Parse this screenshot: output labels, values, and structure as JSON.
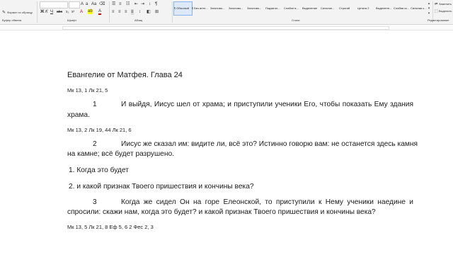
{
  "ribbon": {
    "clipboard": {
      "format_painter": "Формат по образцу",
      "group_label": "Буфер обмена"
    },
    "font": {
      "group_label": "Шрифт",
      "bold": "Ж",
      "italic": "К",
      "underline": "Ч",
      "strike": "abc",
      "subscript": "x₂",
      "superscript": "x²",
      "color": "А"
    },
    "paragraph": {
      "group_label": "Абзац"
    },
    "styles": {
      "group_label": "Стили",
      "items": [
        "¶ Обычный",
        "¶ Без инте...",
        "Заголово...",
        "Заголово...",
        "Заголово...",
        "Подзагол...",
        "Слабое в...",
        "Выделение",
        "Сильное...",
        "Строгий",
        "Цитата 2",
        "Выделенн...",
        "Слабая сс...",
        "Сильная с..."
      ]
    },
    "editing": {
      "replace": "Заменить",
      "select": "Выделить",
      "group_label": "Редактирование"
    }
  },
  "document": {
    "title": "Евангелие от Матфея. Глава 24",
    "ref1": "Мк 13, 1 Лк 21, 5",
    "v1_num": "1",
    "v1_line1": "И выйдя, Иисус шел от храма; и приступили ученики Его, чтобы показать Ему здания",
    "v1_line2": "храма.",
    "ref2": "Мк 13, 2 Лк 19, 44 Лк 21, 6",
    "v2_num": "2",
    "v2_line1": "Иисус же сказал им: видите ли, всё это? Истинно говорю вам: не останется здесь камня",
    "v2_line2": "на камне; всё будет разрушено.",
    "list1": "1. Когда это будет",
    "list2": "2. и какой признак Твоего пришествия и кончины века?",
    "v3_num": "3",
    "v3_line1": "Когда же сидел Он на горе Елеонской, то приступили к Нему ученики наедине и",
    "v3_line2": "спросили: скажи нам, когда это будет? и какой признак Твоего пришествия и кончины века?",
    "ref3": "Мк 13, 5 Лк 21, 8 Еф 5, 6 2 Фес 2, 3"
  }
}
